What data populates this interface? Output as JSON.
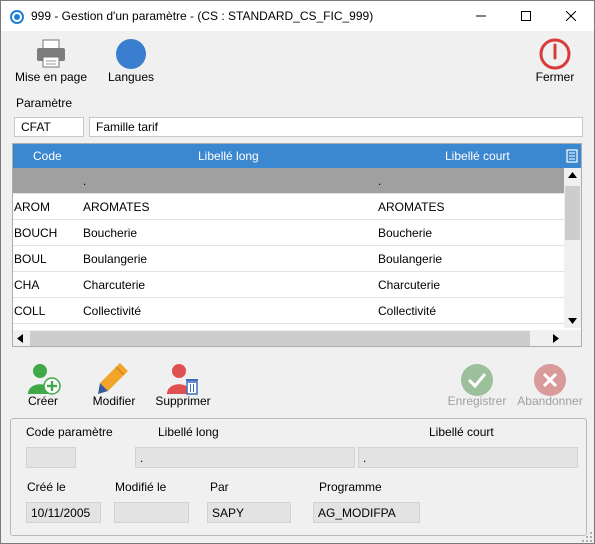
{
  "window": {
    "title": "999 - Gestion d'un paramètre - (CS : STANDARD_CS_FIC_999)"
  },
  "toolbar": {
    "print_label": "Mise en page",
    "languages_label": "Langues",
    "close_label": "Fermer"
  },
  "parametre": {
    "section_label": "Paramètre",
    "code": "CFAT",
    "name": "Famille tarif"
  },
  "grid": {
    "columns": [
      "Code",
      "Libellé long",
      "Libellé court"
    ],
    "selected_row": {
      "code": "",
      "long": ".",
      "short": "."
    },
    "rows": [
      {
        "code": "AROM",
        "long": "AROMATES",
        "short": "AROMATES"
      },
      {
        "code": "BOUCH",
        "long": "Boucherie",
        "short": "Boucherie"
      },
      {
        "code": "BOUL",
        "long": "Boulangerie",
        "short": "Boulangerie"
      },
      {
        "code": "CHA",
        "long": "Charcuterie",
        "short": "Charcuterie"
      },
      {
        "code": "COLL",
        "long": "Collectivité",
        "short": "Collectivité"
      }
    ]
  },
  "actions": {
    "create_label": "Créer",
    "modify_label": "Modifier",
    "delete_label": "Supprimer",
    "save_label": "Enregistrer",
    "cancel_label": "Abandonner"
  },
  "detail": {
    "code_label": "Code paramètre",
    "long_label": "Libellé long",
    "short_label": "Libellé court",
    "code_value": "",
    "long_value": ".",
    "short_value": ".",
    "created_label": "Créé le",
    "modified_label": "Modifié le",
    "by_label": "Par",
    "program_label": "Programme",
    "created_value": "10/11/2005",
    "modified_value": "",
    "by_value": "SAPY",
    "program_value": "AG_MODIFPA"
  },
  "colors": {
    "grid_header": "#3b87d0",
    "selected_row": "#a0a0a0",
    "create_green": "#3fa94a",
    "delete_red": "#e05050",
    "close_red": "#d93b3b"
  }
}
